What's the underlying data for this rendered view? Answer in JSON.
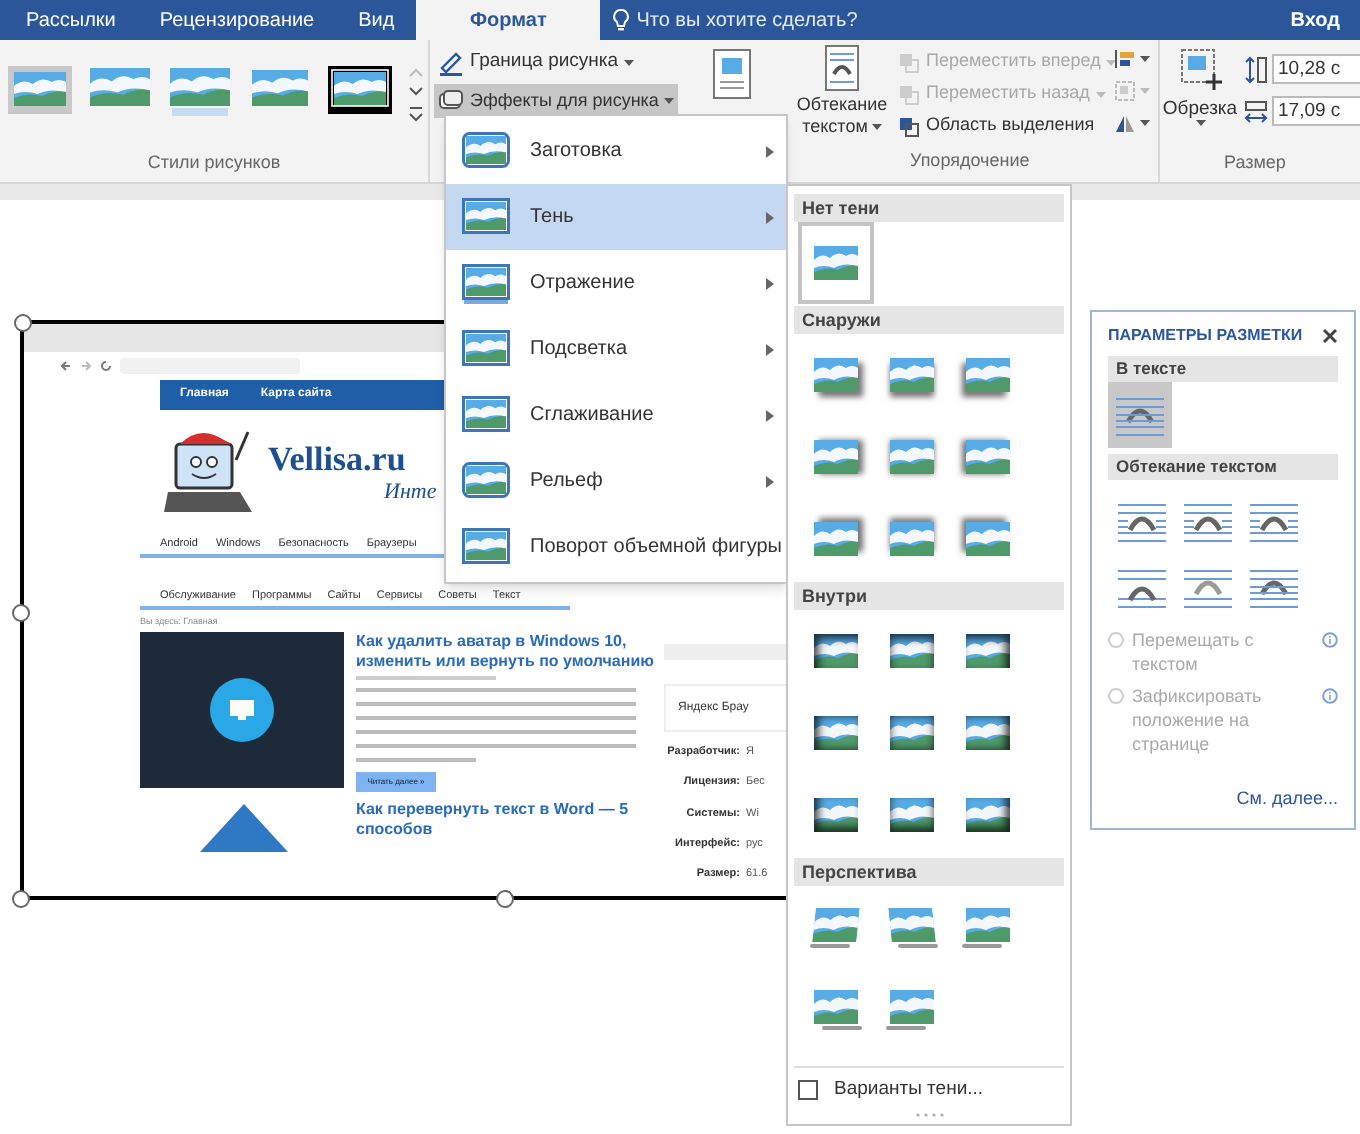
{
  "tabs": [
    {
      "label": "Рассылки",
      "selected": false
    },
    {
      "label": "Рецензирование",
      "selected": false
    },
    {
      "label": "Вид",
      "selected": false
    },
    {
      "label": "Формат",
      "selected": true
    }
  ],
  "tell_me": {
    "placeholder": "Что вы хотите сделать?"
  },
  "sign_in": "Вход",
  "ribbon": {
    "picture_styles": {
      "label": "Стили рисунков"
    },
    "picture_border": "Граница рисунка",
    "picture_effects": {
      "label": "Эффекты для рисунка",
      "pressed": true
    },
    "wrap_text": {
      "line_1": "Обтекание",
      "line_2": "текстом"
    },
    "arrange": [
      {
        "label": "Переместить вперед",
        "disabled": true
      },
      {
        "label": "Переместить назад",
        "disabled": true
      },
      {
        "label": "Область выделения",
        "disabled": false
      }
    ],
    "arrange_label": "Упорядочение",
    "crop": "Обрезка",
    "height": "10,28 с",
    "width": "17,09 с",
    "size_label": "Размер"
  },
  "effects_menu": [
    {
      "label": "Заготовка",
      "selected": false
    },
    {
      "label": "Тень",
      "selected": true
    },
    {
      "label": "Отражение",
      "selected": false
    },
    {
      "label": "Подсветка",
      "selected": false
    },
    {
      "label": "Сглаживание",
      "selected": false
    },
    {
      "label": "Рельеф",
      "selected": false
    },
    {
      "label": "Поворот объемной фигуры",
      "selected": false
    }
  ],
  "shadow_gallery": {
    "sections": [
      {
        "title": "Нет тени",
        "kind": "none",
        "items": [
          {
            "selected": true
          }
        ]
      },
      {
        "title": "Снаружи",
        "kind": "outer",
        "items": [
          {
            "selected": false
          },
          {
            "selected": false
          },
          {
            "selected": false
          },
          {
            "selected": false
          },
          {
            "selected": false
          },
          {
            "selected": false
          },
          {
            "selected": false
          },
          {
            "selected": false
          },
          {
            "selected": false
          }
        ]
      },
      {
        "title": "Внутри",
        "kind": "inner",
        "items": [
          {
            "selected": false
          },
          {
            "selected": false
          },
          {
            "selected": false
          },
          {
            "selected": false
          },
          {
            "selected": false
          },
          {
            "selected": false
          },
          {
            "selected": false
          },
          {
            "selected": false
          },
          {
            "selected": false
          }
        ]
      },
      {
        "title": "Перспектива",
        "kind": "perspective",
        "items": [
          {
            "selected": false
          },
          {
            "selected": false
          },
          {
            "selected": false
          },
          {
            "selected": false
          },
          {
            "selected": false
          }
        ]
      }
    ],
    "options": "Варианты тени..."
  },
  "layout_options": {
    "title": "ПАРАМЕТРЫ РАЗМЕТКИ",
    "in_line": {
      "title": "В тексте",
      "options": [
        {
          "selected": true
        }
      ]
    },
    "wrapping": {
      "title": "Обтекание текстом",
      "options": [
        {
          "selected": false
        },
        {
          "selected": false
        },
        {
          "selected": false
        },
        {
          "selected": false
        },
        {
          "selected": false
        },
        {
          "selected": false
        }
      ]
    },
    "radios": [
      {
        "label": "Перемещать с текстом",
        "selected": false,
        "disabled": true
      },
      {
        "label": "Зафиксировать положение на странице",
        "selected": false,
        "disabled": true
      }
    ],
    "see_more": "См. далее..."
  },
  "picture": {
    "nav": [
      "Главная",
      "Карта сайта"
    ],
    "logo": "Vellisa.ru",
    "tagline": "Инте",
    "menu_row_1": [
      "Android",
      "Windows",
      "Безопасность",
      "Браузеры"
    ],
    "menu_row_2": [
      "Обслуживание",
      "Программы",
      "Сайты",
      "Сервисы",
      "Советы",
      "Текст"
    ],
    "breadcrumb": "Вы здесь: Главная",
    "article_1": {
      "title": "Как удалить аватар в Windows 10, изменить или вернуть по умолчанию",
      "button": "Читать далее »"
    },
    "article_2": {
      "title": "Как перевернуть текст в Word — 5 способов"
    },
    "sidebar": {
      "ad": "Яндекс Брау",
      "rows": [
        {
          "label": "Разработчик:",
          "value": "Я"
        },
        {
          "label": "Лицензия:",
          "value": "Бес"
        },
        {
          "label": "Системы:",
          "value": "Wi"
        },
        {
          "label": "Интерфейс:",
          "value": "рус"
        },
        {
          "label": "Размер:",
          "value": "61.6"
        }
      ]
    }
  }
}
